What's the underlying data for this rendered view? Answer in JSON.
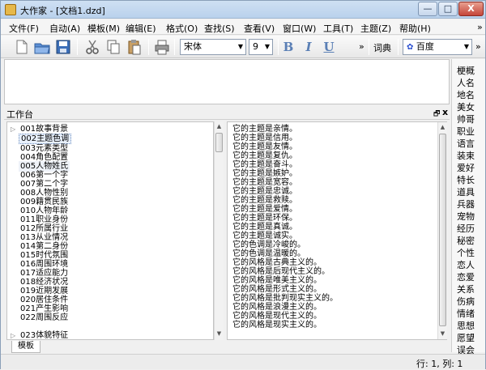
{
  "window": {
    "title": "大作家 - [文档1.dzd]",
    "minimize_glyph": "—",
    "maximize_glyph": "□",
    "close_glyph": "X"
  },
  "menu": {
    "items": [
      "文件(F)",
      "自动(A)",
      "模板(M)",
      "编辑(E)",
      "格式(O)",
      "查找(S)",
      "查看(V)",
      "窗口(W)",
      "工具(T)",
      "主题(Z)",
      "帮助(H)"
    ],
    "overflow": "»"
  },
  "toolbar": {
    "font_name": "宋体",
    "font_size": "9",
    "bold": "B",
    "italic": "I",
    "underline": "U",
    "overflow": "»",
    "dictionary": "词典",
    "search_engine": "百度"
  },
  "right_panel": {
    "items": [
      "梗概",
      "人名",
      "地名",
      "美女",
      "帅哥",
      "职业",
      "语言",
      "装束",
      "爱好",
      "特长",
      "道具",
      "兵器",
      "宠物",
      "经历",
      "秘密",
      "个性",
      "恋人",
      "恋爱",
      "关系",
      "伤病",
      "情绪",
      "思想",
      "愿望",
      "误会"
    ],
    "more": "¥"
  },
  "workbench": {
    "title": "工作台",
    "pin": "🗗",
    "close": "x"
  },
  "tree": {
    "items": [
      "001故事背景",
      "002主题色调",
      "003元素类型",
      "004角色配置",
      "005人物姓氏",
      "006第一个字",
      "007第二个字",
      "008人物性别",
      "009籍贯民族",
      "010人物年龄",
      "011职业身份",
      "012所属行业",
      "013从业情况",
      "014第二身份",
      "015时代氛围",
      "016周围环境",
      "017适应能力",
      "018经济状况",
      "019近期发展",
      "020居住条件",
      "021产生影响",
      "022周围反应",
      "023体貌特征"
    ],
    "selected_index": 1
  },
  "list": {
    "items": [
      "它的主题是亲情。",
      "它的主题是信用。",
      "它的主题是友情。",
      "它的主题是复仇。",
      "它的主题是奋斗。",
      "它的主题是嫉妒。",
      "它的主题是宽容。",
      "它的主题是忠诚。",
      "它的主题是救赎。",
      "它的主题是爱情。",
      "它的主题是环保。",
      "它的主题是真诚。",
      "它的主题是诚实。",
      "它的色调是冷峻的。",
      "它的色调是温暖的。",
      "它的风格是古典主义的。",
      "它的风格是后现代主义的。",
      "它的风格是唯美主义的。",
      "它的风格是形式主义的。",
      "它的风格是批判现实主义的。",
      "它的风格是浪漫主义的。",
      "它的风格是现代主义的。",
      "它的风格是现实主义的。"
    ]
  },
  "tabs": [
    "模板"
  ],
  "status": {
    "position": "行: 1,  列: 1"
  }
}
